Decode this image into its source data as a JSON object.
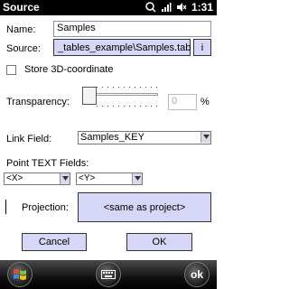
{
  "titlebar": {
    "title": "Source",
    "time": "1:31",
    "icons": [
      "connectivity-icon",
      "signal-icon",
      "volume-mute-icon"
    ]
  },
  "form": {
    "name_label": "Name:",
    "name_value": "Samples",
    "source_label": "Source:",
    "source_value": "_tables_example\\Samples.tab",
    "info_button": "i",
    "store3d_label": "Store 3D-coordinate",
    "store3d_checked": false,
    "transparency_label": "Transparency:",
    "transparency_value": "0",
    "transparency_unit": "%",
    "transparency_level": 0,
    "linkfield_label": "Link Field:",
    "linkfield_value": "Samples_KEY",
    "point_text_label": "Point TEXT Fields:",
    "x_field": "<X>",
    "y_field": "<Y>",
    "projection_label": "Projection:",
    "projection_button": "<same as project>",
    "cancel_button": "Cancel",
    "ok_button": "OK"
  },
  "softkeys": {
    "right_label": "ok",
    "left_icon": "windows-start-icon",
    "center_icon": "keyboard-icon"
  }
}
